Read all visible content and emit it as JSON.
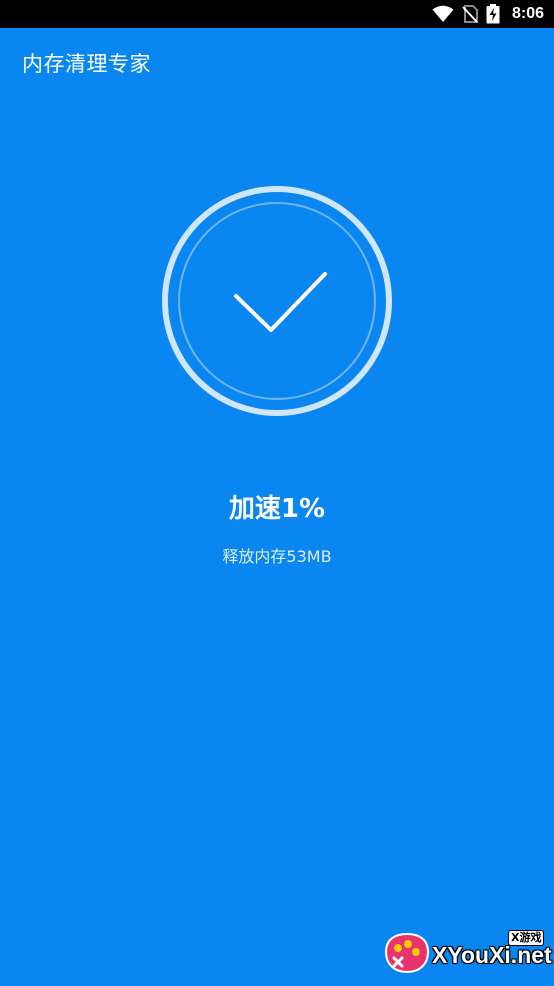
{
  "status_bar": {
    "time": "8:06",
    "icons": [
      "wifi-icon",
      "no-sim-icon",
      "battery-charging-icon"
    ]
  },
  "app_bar": {
    "title": "内存清理专家"
  },
  "result": {
    "icon": "checkmark-icon",
    "title": "加速1%",
    "subtitle": "释放内存53MB"
  },
  "watermark": {
    "site": "XYouXi.net",
    "tag": "X游戏"
  },
  "colors": {
    "background": "#0a86f0",
    "status_bar": "#000000",
    "ring": "#cfe6ff"
  }
}
